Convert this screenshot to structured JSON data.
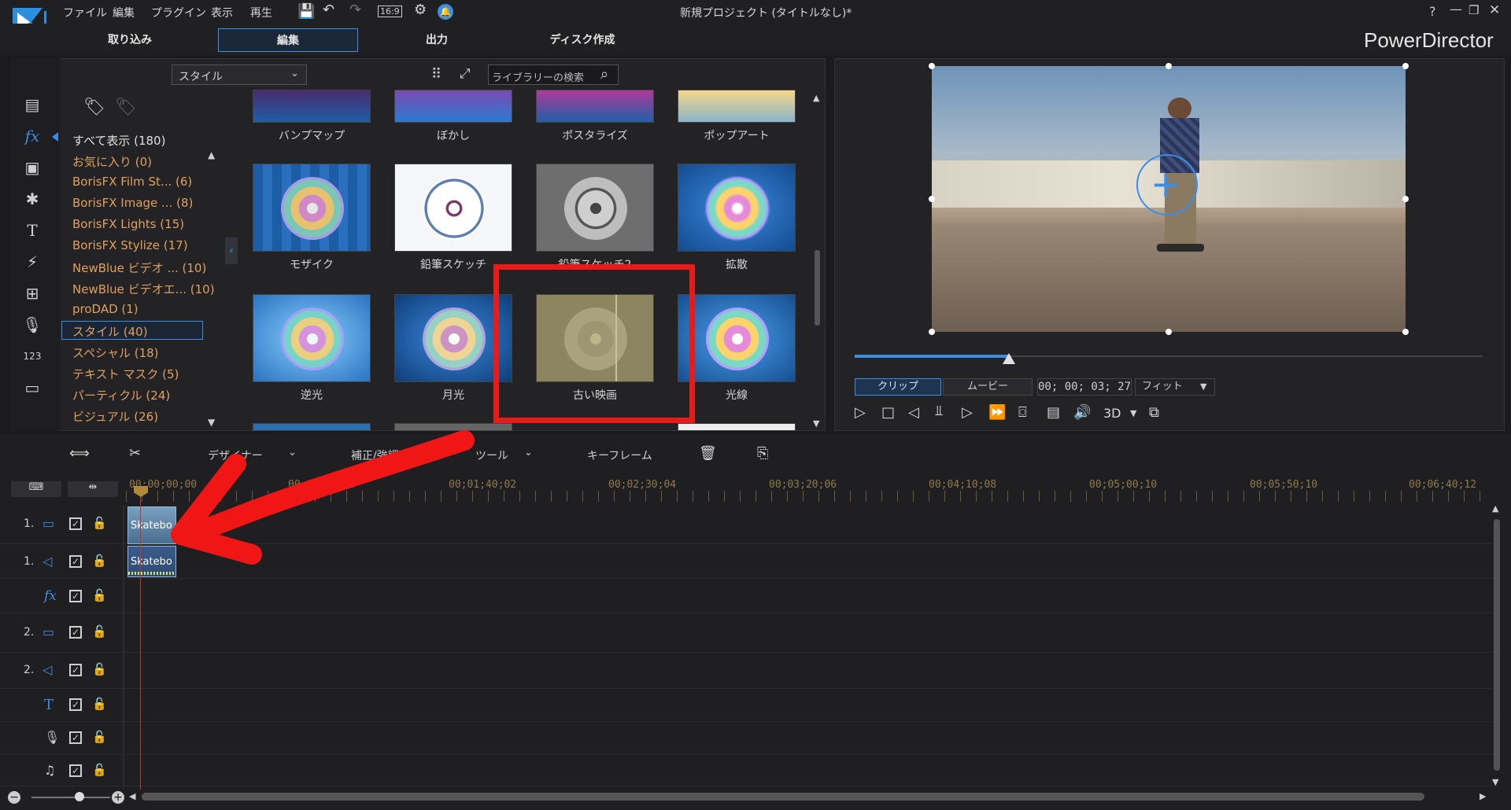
{
  "titlebar": {
    "title": "新規プロジェクト (タイトルなし)*",
    "menus": [
      "ファイル",
      "編集",
      "プラグイン",
      "表示",
      "再生"
    ],
    "aspect": "16:9",
    "help": "?"
  },
  "tabs": [
    {
      "label": "取り込み"
    },
    {
      "label": "編集"
    },
    {
      "label": "出力"
    },
    {
      "label": "ディスク作成"
    }
  ],
  "brand": "PowerDirector",
  "library": {
    "dropdown": "スタイル",
    "search_placeholder": "ライブラリーの検索",
    "categories": [
      {
        "label": "すべて表示 (180)"
      },
      {
        "label": "お気に入り (0)"
      },
      {
        "label": "BorisFX Film St... (6)"
      },
      {
        "label": "BorisFX Image ... (8)"
      },
      {
        "label": "BorisFX Lights (15)"
      },
      {
        "label": "BorisFX Stylize (17)"
      },
      {
        "label": "NewBlue ビデオ ... (10)"
      },
      {
        "label": "NewBlue ビデオエ... (10)"
      },
      {
        "label": "proDAD (1)"
      },
      {
        "label": "スタイル (40)"
      },
      {
        "label": "スペシャル (18)"
      },
      {
        "label": "テキスト マスク (5)"
      },
      {
        "label": "パーティクル (24)"
      },
      {
        "label": "ビジュアル (26)"
      }
    ],
    "effects": [
      {
        "label": "バンプマップ"
      },
      {
        "label": "ぼかし"
      },
      {
        "label": "ポスタライズ"
      },
      {
        "label": "ポップアート"
      },
      {
        "label": "モザイク"
      },
      {
        "label": "鉛筆スケッチ"
      },
      {
        "label": "鉛筆スケッチ2"
      },
      {
        "label": "拡散"
      },
      {
        "label": "逆光"
      },
      {
        "label": "月光"
      },
      {
        "label": "古い映画"
      },
      {
        "label": "光線"
      }
    ],
    "highlighted_effect": "古い映画"
  },
  "preview": {
    "mode_clip": "クリップ",
    "mode_movie": "ムービー",
    "timecode": "00; 00; 03; 27",
    "fit": "フィット",
    "threed": "3D"
  },
  "timeline_toolbar": {
    "designer": "デザイナー",
    "correction": "補正/強調",
    "tools": "ツール",
    "keyframe": "キーフレーム"
  },
  "ruler": [
    "00;00;00;00",
    "00;00;50;00",
    "00;01;40;02",
    "00;02;30;04",
    "00;03;20;06",
    "00;04;10;08",
    "00;05;00;10",
    "00;05;50;10",
    "00;06;40;12"
  ],
  "tracks": [
    {
      "num": "1.",
      "kind": "video"
    },
    {
      "num": "1.",
      "kind": "audio"
    },
    {
      "num": "",
      "kind": "fx"
    },
    {
      "num": "2.",
      "kind": "video"
    },
    {
      "num": "2.",
      "kind": "audio"
    },
    {
      "num": "",
      "kind": "title"
    },
    {
      "num": "",
      "kind": "voice"
    },
    {
      "num": "",
      "kind": "music"
    }
  ],
  "clip": {
    "video_label": "Skatebo",
    "audio_label": "Skatebo"
  },
  "colors": {
    "accent": "#3a8ee6",
    "highlight_box": "#e81b1b",
    "arrow": "#f01616",
    "category": "#e0a060"
  }
}
